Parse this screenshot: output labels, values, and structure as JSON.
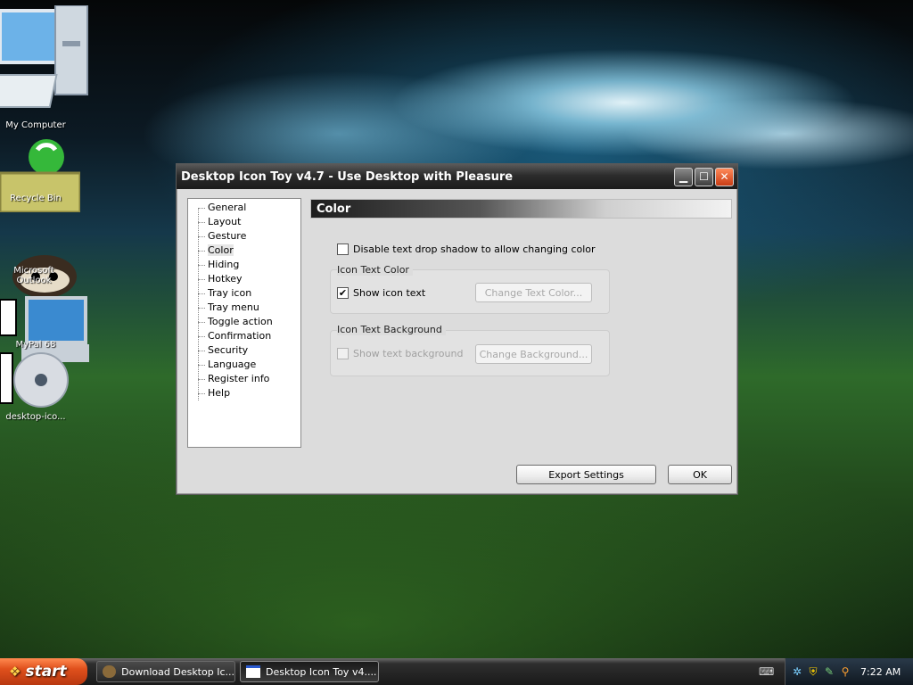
{
  "desktop": {
    "icons": [
      {
        "label": "My Computer"
      },
      {
        "label": "Recycle Bin"
      },
      {
        "label": "Microsoft Outlook"
      },
      {
        "label": "MyPal 68"
      },
      {
        "label": "desktop-ico..."
      }
    ]
  },
  "window": {
    "title": "Desktop Icon Toy v4.7 - Use Desktop with Pleasure",
    "nav_items": [
      "General",
      "Layout",
      "Gesture",
      "Color",
      "Hiding",
      "Hotkey",
      "Tray icon",
      "Tray menu",
      "Toggle action",
      "Confirmation",
      "Security",
      "Language",
      "Register info",
      "Help"
    ],
    "selected_nav": "Color",
    "section_title": "Color",
    "disable_shadow_label": "Disable text drop shadow to allow changing color",
    "disable_shadow_checked": false,
    "icon_text_color": {
      "group_label": "Icon Text Color",
      "show_label": "Show icon text",
      "show_checked": true,
      "change_button": "Change Text Color..."
    },
    "icon_text_background": {
      "group_label": "Icon Text Background",
      "show_label": "Show text background",
      "show_checked": false,
      "change_button": "Change Background..."
    },
    "export_button": "Export Settings",
    "ok_button": "OK",
    "check_mark": "✔",
    "minimize_glyph": "▁",
    "maximize_glyph": "☐",
    "close_glyph": "✕"
  },
  "taskbar": {
    "start_label": "start",
    "tasks": [
      "Download Desktop Ic...",
      "Desktop Icon Toy v4...."
    ],
    "clock": "7:22 AM"
  }
}
